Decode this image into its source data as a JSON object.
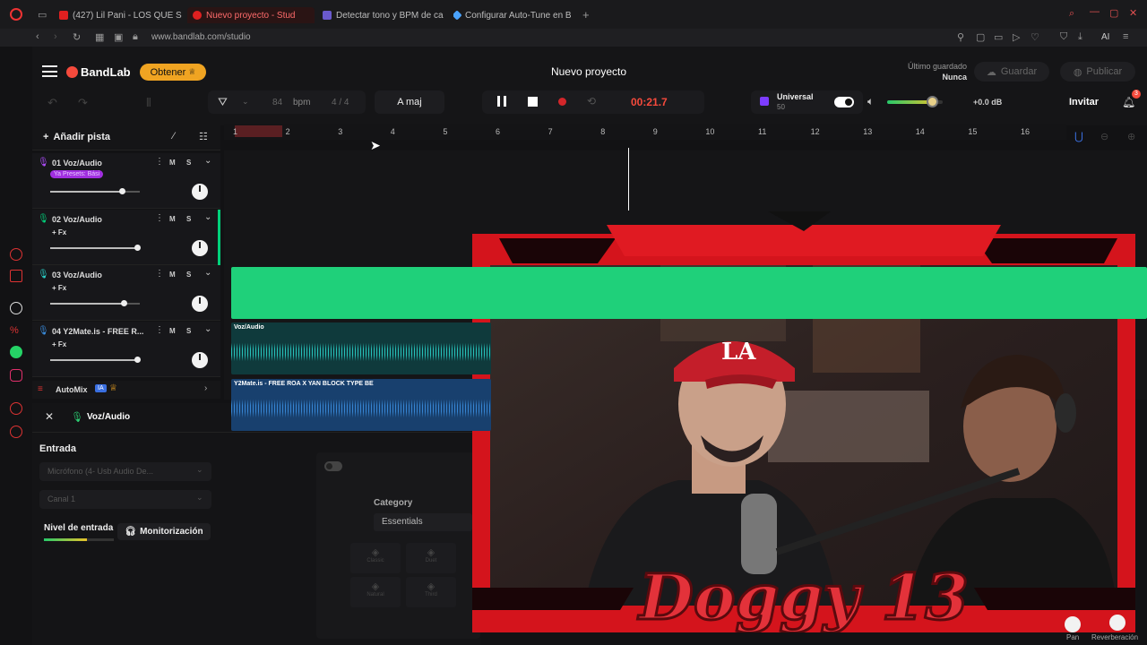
{
  "browser": {
    "tabs": [
      {
        "label": "(427) Lil Pani - LOS QUE S",
        "color": "#e02020"
      },
      {
        "label": "Nuevo proyecto - Stud",
        "color": "#e02020"
      },
      {
        "label": "Detectar tono y BPM de ca",
        "color": "#6a5acd"
      },
      {
        "label": "Configurar Auto-Tune en B",
        "color": "#4aa3ff"
      }
    ],
    "url": "www.bandlab.com/studio",
    "ai_label": "AI"
  },
  "app": {
    "brand": "BandLab",
    "get_button": "Obtener",
    "project_title": "Nuevo proyecto",
    "last_saved_label": "Último guardado",
    "last_saved_value": "Nunca",
    "save_button": "Guardar",
    "publish_button": "Publicar",
    "invite_button": "Invitar",
    "notif_count": "3",
    "accent": "#f54a3c"
  },
  "transport": {
    "bpm_value": "84",
    "bpm_unit": "bpm",
    "time_signature": "4 / 4",
    "key": "A maj",
    "time": "00:21.7",
    "universal_label": "Universal",
    "universal_value": "50",
    "master_db": "+0.0 dB",
    "master_volume": 0.9
  },
  "toolbar": {
    "add_track": "Añadir pista"
  },
  "ruler": [
    "1",
    "2",
    "3",
    "4",
    "5",
    "6",
    "7",
    "8",
    "9",
    "10",
    "11",
    "12",
    "13",
    "14",
    "15",
    "16"
  ],
  "tracks": [
    {
      "name": "01  Voz/Audio",
      "badge": "Ya Presets: Bási",
      "volume": 0.8,
      "color": "#b04dff",
      "clip": "",
      "clip_color": ""
    },
    {
      "name": "02  Voz/Audio",
      "fx": "+ Fx",
      "volume": 0.97,
      "color": "#00d17a",
      "clip": "",
      "clip_color": "#1fd07a"
    },
    {
      "name": "03  Voz/Audio",
      "fx": "+ Fx",
      "volume": 0.82,
      "color": "#2ad0c8",
      "clip": "Voz/Audio",
      "clip_color": "#0f3a3c"
    },
    {
      "name": "04  Y2Mate.is - FREE R...",
      "fx": "+ Fx",
      "volume": 0.97,
      "color": "#3a8dde",
      "clip": "Y2Mate.is - FREE ROA X YAN BLOCK TYPE BE",
      "clip_color": "#18406e"
    }
  ],
  "track_buttons": {
    "mute": "M",
    "solo": "S"
  },
  "automix": {
    "label": "AutoMix",
    "badge": "IA"
  },
  "inspector": {
    "track_name": "Voz/Audio",
    "input_label": "Entrada",
    "input_device": "Micrófono (4- Usb Audio De...",
    "channel": "Canal 1",
    "level_label": "Nivel de entrada",
    "monitor_button": "Monitorización",
    "category_label": "Category",
    "category_value": "Essentials",
    "presets": [
      "Classic",
      "Duet",
      "Natural",
      "Third"
    ]
  },
  "knob_labels": {
    "pan": "Pan",
    "reverb": "Reverberación"
  },
  "overlay": {
    "logo_text": "Doggy 13",
    "frame_color": "#d4141c"
  }
}
